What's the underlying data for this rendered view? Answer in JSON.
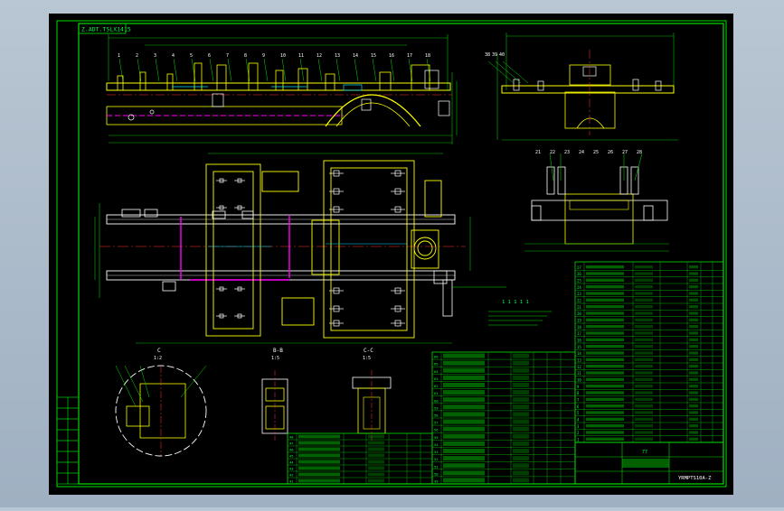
{
  "title_block": {
    "drawing_no": "Z.ADT.TSLX1415",
    "title_code": "YRMPTS10A-Z"
  },
  "section_labels": {
    "c": "C",
    "c_scale": "1:2",
    "bb": "B-B",
    "bb_scale": "1:5",
    "cc": "C-C",
    "cc_scale": "1:5"
  },
  "part_numbers_top": [
    "1",
    "2",
    "3",
    "4",
    "5",
    "6",
    "7",
    "8",
    "9",
    "10",
    "11",
    "12",
    "13",
    "14",
    "15",
    "16",
    "17",
    "18"
  ],
  "part_numbers_right": [
    "38",
    "39",
    "40",
    "21",
    "22",
    "23",
    "24",
    "25",
    "26",
    "27",
    "28"
  ],
  "bom_right_rows": [
    "27",
    "26",
    "25",
    "24",
    "23",
    "22",
    "21",
    "20",
    "19",
    "18",
    "17",
    "16",
    "15",
    "14",
    "13",
    "12",
    "11",
    "10",
    "9",
    "8",
    "7",
    "6",
    "5",
    "4",
    "3",
    "2",
    "1"
  ],
  "bom_middle_rows": [
    "66",
    "65",
    "64",
    "63",
    "62",
    "61",
    "60",
    "59",
    "58",
    "57",
    "56",
    "55",
    "54",
    "53",
    "52",
    "51",
    "50",
    "49",
    "48",
    "47",
    "46",
    "45",
    "44",
    "43",
    "42",
    "41"
  ],
  "note_1": "1 1 1 1 1",
  "note_2": "77"
}
